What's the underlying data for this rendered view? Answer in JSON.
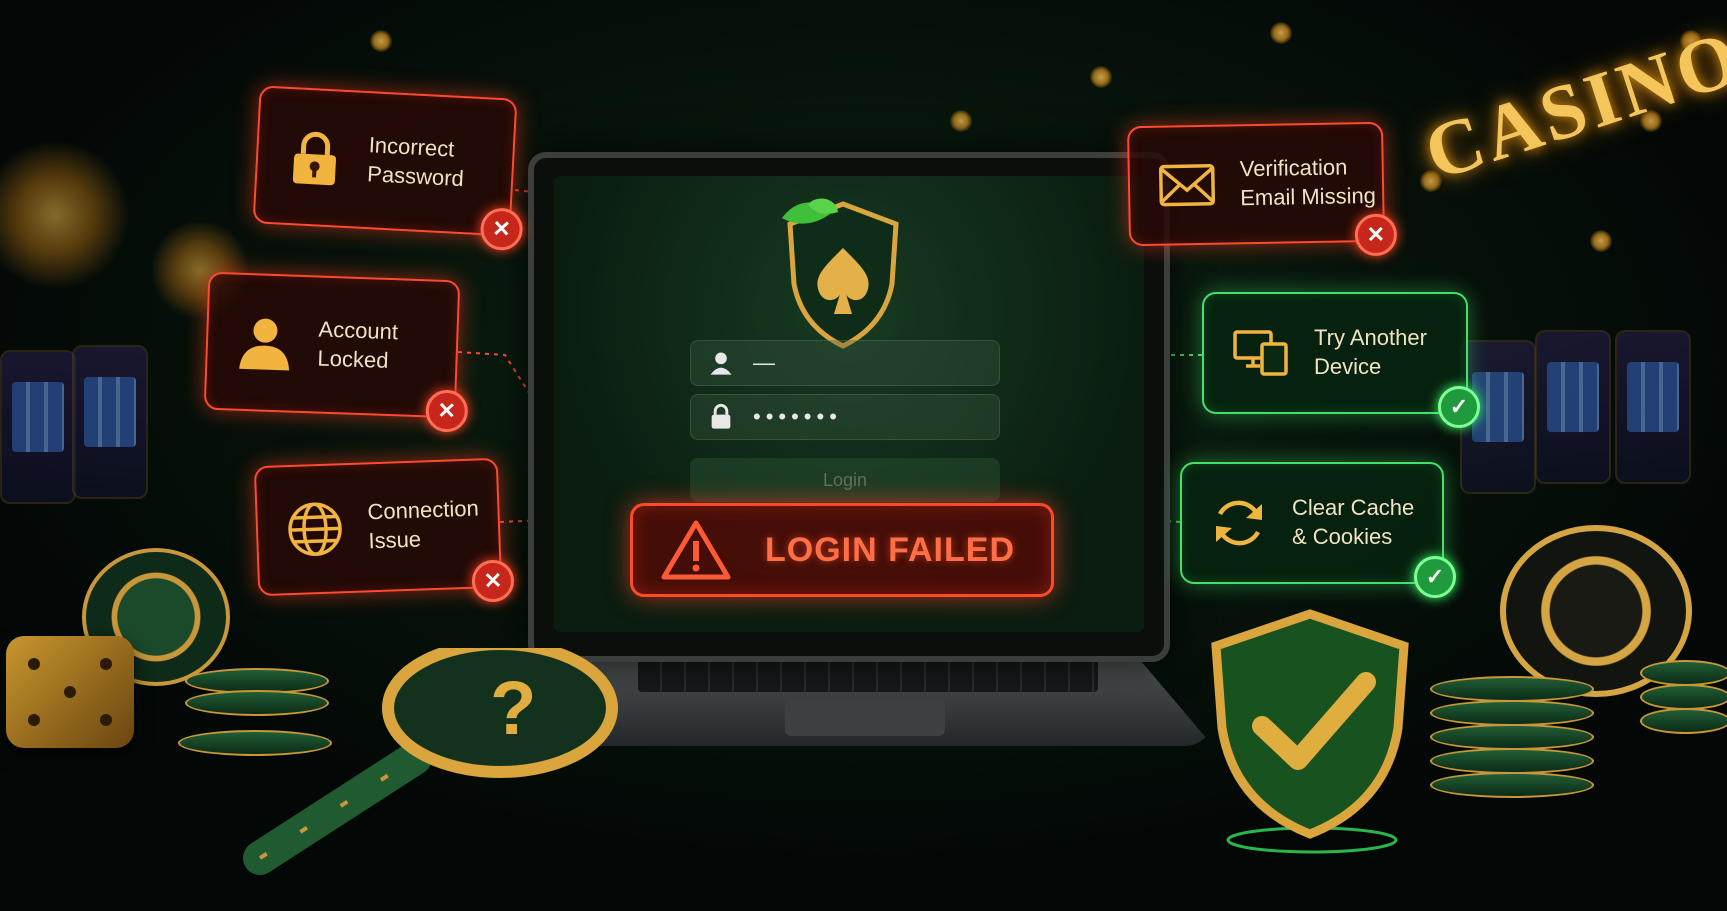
{
  "background": {
    "sign_text": "CASINO"
  },
  "login_screen": {
    "username_value": "—",
    "password_value": "•••••••",
    "login_button_label": "Login",
    "error_banner": "LOGIN FAILED"
  },
  "problems": [
    {
      "line1": "Incorrect",
      "line2": "Password",
      "icon": "lock-icon",
      "status": "error"
    },
    {
      "line1": "Account",
      "line2": "Locked",
      "icon": "user-icon",
      "status": "error"
    },
    {
      "line1": "Connection",
      "line2": "Issue",
      "icon": "globe-icon",
      "status": "error"
    },
    {
      "line1": "Verification",
      "line2": "Email Missing",
      "icon": "envelope-icon",
      "status": "error"
    }
  ],
  "solutions": [
    {
      "line1": "Try Another",
      "line2": "Device",
      "icon": "devices-icon",
      "status": "ok"
    },
    {
      "line1": "Clear Cache",
      "line2": "& Cookies",
      "icon": "refresh-icon",
      "status": "ok"
    }
  ],
  "colors": {
    "error": "#ff4a30",
    "success": "#45e06a",
    "gold": "#e0ad3f",
    "background": "#07140b"
  }
}
